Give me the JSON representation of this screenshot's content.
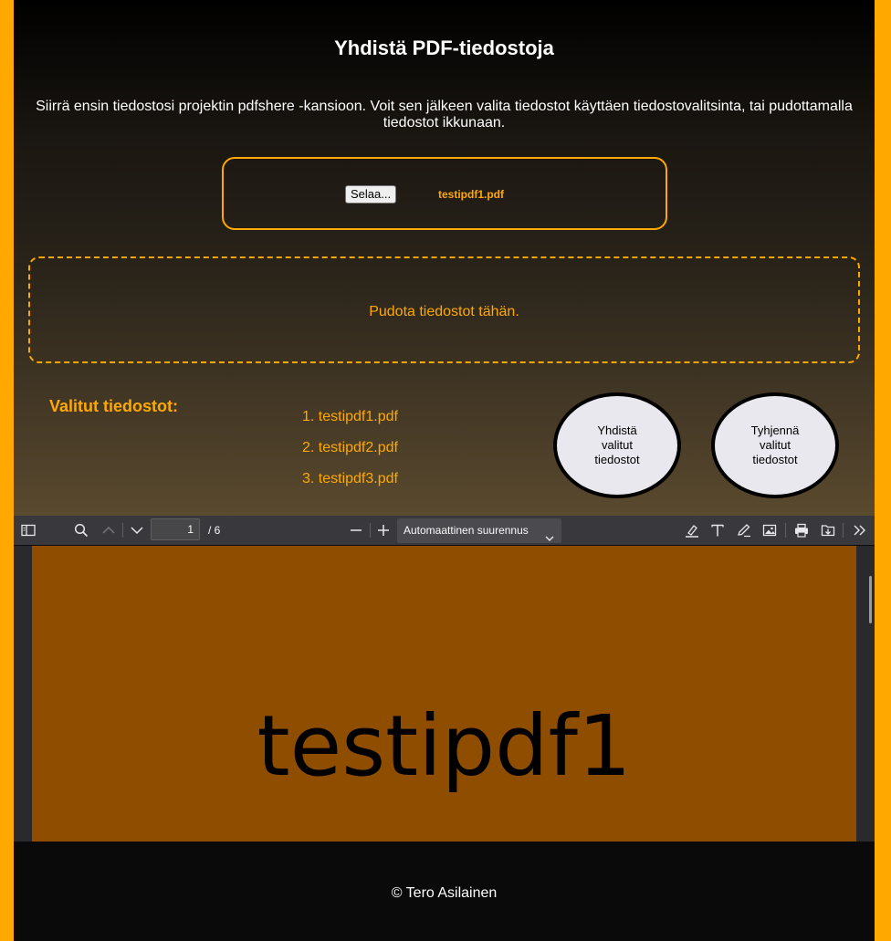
{
  "header": {
    "title": "Yhdistä PDF-tiedostoja",
    "intro": "Siirrä ensin tiedostosi projektin pdfshere -kansioon. Voit sen jälkeen valita tiedostot käyttäen tiedostovalitsinta, tai pudottamalla tiedostot ikkunaan."
  },
  "file_picker": {
    "browse_label": "Selaa...",
    "selected_file": "testipdf1.pdf"
  },
  "dropzone": {
    "text": "Pudota tiedostot tähän."
  },
  "selected": {
    "label": "Valitut tiedostot:",
    "files": [
      "1. testipdf1.pdf",
      "2. testipdf2.pdf",
      "3. testipdf3.pdf"
    ]
  },
  "actions": {
    "merge_label": "Yhdistä valitut tiedostot",
    "clear_label": "Tyhjennä valitut tiedostot"
  },
  "pdf_viewer": {
    "page_number": "1",
    "page_total": "/ 6",
    "zoom_label": "Automaattinen suurennus",
    "page_text": "testipdf1",
    "icons": [
      "sidebar-toggle-icon",
      "search-icon",
      "previous-page-icon",
      "next-page-icon",
      "zoom-out-icon",
      "zoom-in-icon",
      "highlight-icon",
      "text-icon",
      "draw-icon",
      "image-icon",
      "print-icon",
      "download-icon",
      "more-tools-icon"
    ]
  },
  "footer": {
    "text": "© Tero Asilainen"
  },
  "colors": {
    "accent": "#ffa900",
    "page_background": "#8f4d00",
    "button_background": "#e9e8ee"
  }
}
